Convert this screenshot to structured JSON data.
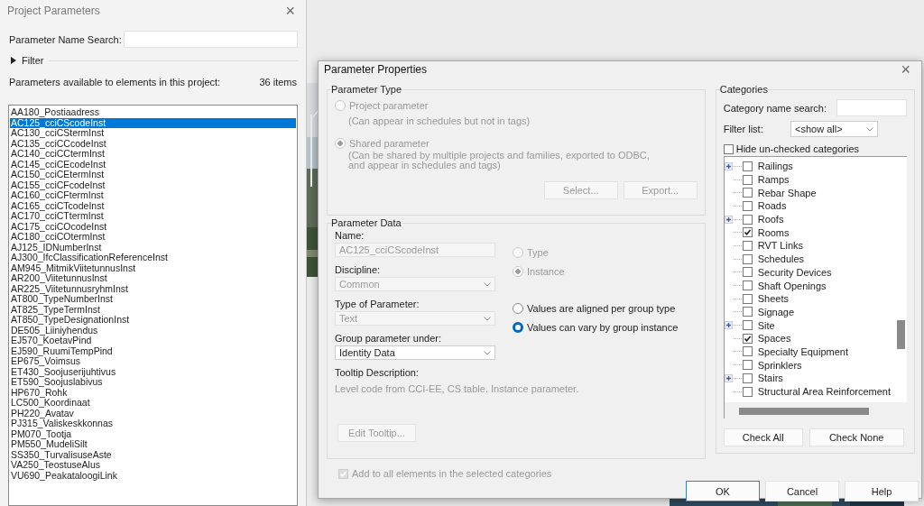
{
  "project_parameters": {
    "title": "Project Parameters",
    "close": "×",
    "search_label": "Parameter Name Search:",
    "filter_label": "Filter",
    "available_label": "Parameters available to elements in this project:",
    "count": "36 items",
    "items": [
      {
        "label": "AA180_Postiaadress",
        "selected": false
      },
      {
        "label": "AC125_cciCScodeInst",
        "selected": true
      },
      {
        "label": "AC130_cciCStermInst",
        "selected": false
      },
      {
        "label": "AC135_cciCCcodeInst",
        "selected": false
      },
      {
        "label": "AC140_cciCCtermInst",
        "selected": false
      },
      {
        "label": "AC145_cciCEcodeInst",
        "selected": false
      },
      {
        "label": "AC150_cciCEtermInst",
        "selected": false
      },
      {
        "label": "AC155_cciCFcodeInst",
        "selected": false
      },
      {
        "label": "AC160_cciCFtermInst",
        "selected": false
      },
      {
        "label": "AC165_cciCTcodeInst",
        "selected": false
      },
      {
        "label": "AC170_cciCTtermInst",
        "selected": false
      },
      {
        "label": "AC175_cciCOcodeInst",
        "selected": false
      },
      {
        "label": "AC180_cciCOtermInst",
        "selected": false
      },
      {
        "label": "AJ125_IDNumberInst",
        "selected": false
      },
      {
        "label": "AJ300_IfcClassificationReferenceInst",
        "selected": false
      },
      {
        "label": "AM945_MitmikViitetunnusInst",
        "selected": false
      },
      {
        "label": "AR200_ViitetunnusInst",
        "selected": false
      },
      {
        "label": "AR225_ViitetunnusryhmInst",
        "selected": false
      },
      {
        "label": "AT800_TypeNumberInst",
        "selected": false
      },
      {
        "label": "AT825_TypeTermInst",
        "selected": false
      },
      {
        "label": "AT850_TypeDesignationInst",
        "selected": false
      },
      {
        "label": "DE505_Liiniyhendus",
        "selected": false
      },
      {
        "label": "EJ570_KoetavPind",
        "selected": false
      },
      {
        "label": "EJ590_RuumiTempPind",
        "selected": false
      },
      {
        "label": "EP675_Voimsus",
        "selected": false
      },
      {
        "label": "ET430_Soojuserijuhtivus",
        "selected": false
      },
      {
        "label": "ET590_Soojuslabivus",
        "selected": false
      },
      {
        "label": "HP670_Rohk",
        "selected": false
      },
      {
        "label": "LC500_Koordinaat",
        "selected": false
      },
      {
        "label": "PH220_Avatav",
        "selected": false
      },
      {
        "label": "PJ315_Valiskeskkonnas",
        "selected": false
      },
      {
        "label": "PM070_Tootja",
        "selected": false
      },
      {
        "label": "PM550_MudeliSilt",
        "selected": false
      },
      {
        "label": "SS350_TurvalisuseAste",
        "selected": false
      },
      {
        "label": "VA250_TeostuseAlus",
        "selected": false
      },
      {
        "label": "VU690_PeakataloogiLink",
        "selected": false
      }
    ]
  },
  "parameter_properties": {
    "title": "Parameter Properties",
    "close": "×",
    "parameter_type": {
      "heading": "Parameter Type",
      "disabled": true,
      "options": [
        {
          "label": "Project parameter",
          "hint": "(Can appear in schedules but not in tags)",
          "selected": false
        },
        {
          "label": "Shared parameter",
          "hint": "(Can be shared by multiple projects and families, exported to ODBC, and appear in schedules and tags)",
          "selected": true
        }
      ],
      "buttons": [
        "Select...",
        "Export..."
      ]
    },
    "parameter_data": {
      "heading": "Parameter Data",
      "name_label": "Name:",
      "name_value": "AC125_cciCScodeInst",
      "discipline_label": "Discipline:",
      "discipline_value": "Common",
      "discipline_disabled": true,
      "type_label": "Type of Parameter:",
      "type_value": "Text",
      "type_disabled": true,
      "group_label": "Group parameter under:",
      "group_value": "Identity Data",
      "tooltip_label": "Tooltip Description:",
      "tooltip_text": "Level code from CCI-EE, CS table. Instance parameter.",
      "edit_tooltip": "Edit Tooltip...",
      "scope_disabled": true,
      "scope_options": [
        {
          "label": "Type",
          "selected": false
        },
        {
          "label": "Instance",
          "selected": true
        }
      ],
      "group_options": [
        {
          "label": "Values are aligned per group type",
          "selected": false
        },
        {
          "label": "Values can vary by group instance",
          "selected": true
        }
      ]
    },
    "add_to_all": {
      "label": "Add to all elements in the selected categories",
      "checked": true,
      "disabled": true
    },
    "categories": {
      "heading": "Categories",
      "search_label": "Category name search:",
      "filter_label": "Filter list:",
      "filter_value": "<show all>",
      "hide_label": "Hide un-checked categories",
      "hide_checked": false,
      "items": [
        {
          "label": "Railings",
          "kind": "group",
          "checked": false
        },
        {
          "label": "Ramps",
          "kind": "leaf",
          "checked": false
        },
        {
          "label": "Rebar Shape",
          "kind": "leaf",
          "checked": false
        },
        {
          "label": "Roads",
          "kind": "leaf",
          "checked": false
        },
        {
          "label": "Roofs",
          "kind": "group",
          "checked": false
        },
        {
          "label": "Rooms",
          "kind": "leaf",
          "checked": true
        },
        {
          "label": "RVT Links",
          "kind": "leaf",
          "checked": false
        },
        {
          "label": "Schedules",
          "kind": "leaf",
          "checked": false
        },
        {
          "label": "Security Devices",
          "kind": "leaf",
          "checked": false
        },
        {
          "label": "Shaft Openings",
          "kind": "leaf",
          "checked": false
        },
        {
          "label": "Sheets",
          "kind": "leaf",
          "checked": false
        },
        {
          "label": "Signage",
          "kind": "leaf",
          "checked": false
        },
        {
          "label": "Site",
          "kind": "group",
          "checked": false
        },
        {
          "label": "Spaces",
          "kind": "leaf",
          "checked": true
        },
        {
          "label": "Specialty Equipment",
          "kind": "leaf",
          "checked": false
        },
        {
          "label": "Sprinklers",
          "kind": "leaf",
          "checked": false
        },
        {
          "label": "Stairs",
          "kind": "group",
          "checked": false
        },
        {
          "label": "Structural Area Reinforcement",
          "kind": "leaf",
          "checked": false
        }
      ],
      "buttons": [
        "Check All",
        "Check None"
      ]
    },
    "buttons": [
      {
        "label": "OK",
        "default": true
      },
      {
        "label": "Cancel",
        "default": false
      },
      {
        "label": "Help",
        "default": false
      }
    ]
  }
}
